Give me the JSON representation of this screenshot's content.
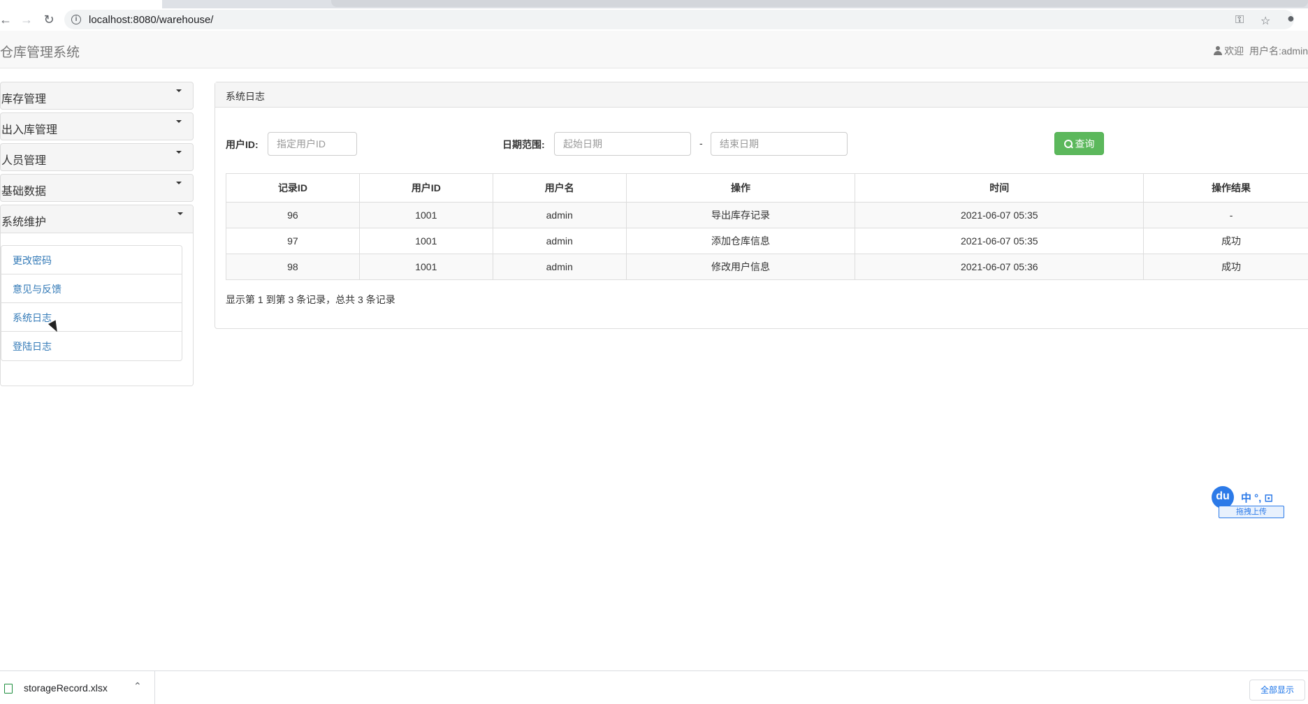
{
  "browser": {
    "url": "localhost:8080/warehouse/",
    "icons": [
      "back-icon",
      "forward-icon",
      "reload-icon",
      "info-icon",
      "key-icon",
      "star-icon",
      "profile-icon"
    ]
  },
  "header": {
    "app_title": "仓库管理系统",
    "welcome": "欢迎",
    "username": "用户名:admin"
  },
  "sidebar": {
    "menus": [
      {
        "label": "库存管理"
      },
      {
        "label": "出入库管理"
      },
      {
        "label": "人员管理"
      },
      {
        "label": "基础数据"
      }
    ],
    "expanded": {
      "label": "系统维护",
      "items": [
        {
          "label": "更改密码"
        },
        {
          "label": "意见与反馈"
        },
        {
          "label": "系统日志"
        },
        {
          "label": "登陆日志"
        }
      ]
    }
  },
  "panel": {
    "heading": "系统日志",
    "filters": {
      "user_id_label": "用户ID:",
      "user_id_placeholder": "指定用户ID",
      "date_range_label": "日期范围:",
      "start_placeholder": "起始日期",
      "dash": "-",
      "end_placeholder": "结束日期",
      "query_button": "查询"
    },
    "table": {
      "columns": [
        "记录ID",
        "用户ID",
        "用户名",
        "操作",
        "时间",
        "操作结果"
      ],
      "rows": [
        [
          "96",
          "1001",
          "admin",
          "导出库存记录",
          "2021-06-07 05:35",
          "-"
        ],
        [
          "97",
          "1001",
          "admin",
          "添加仓库信息",
          "2021-06-07 05:35",
          "成功"
        ],
        [
          "98",
          "1001",
          "admin",
          "修改用户信息",
          "2021-06-07 05:36",
          "成功"
        ]
      ]
    },
    "pagination": "显示第 1 到第 3 条记录，总共 3 条记录"
  },
  "ime": {
    "logo": "du",
    "items": "中 °, ⊡",
    "upload": "拖拽上传"
  },
  "downloads": {
    "file_name": "storageRecord.xlsx",
    "show_all": "全部显示"
  },
  "colors": {
    "success": "#5cb85c",
    "link": "#337ab7",
    "panel_bg": "#f5f5f5"
  }
}
